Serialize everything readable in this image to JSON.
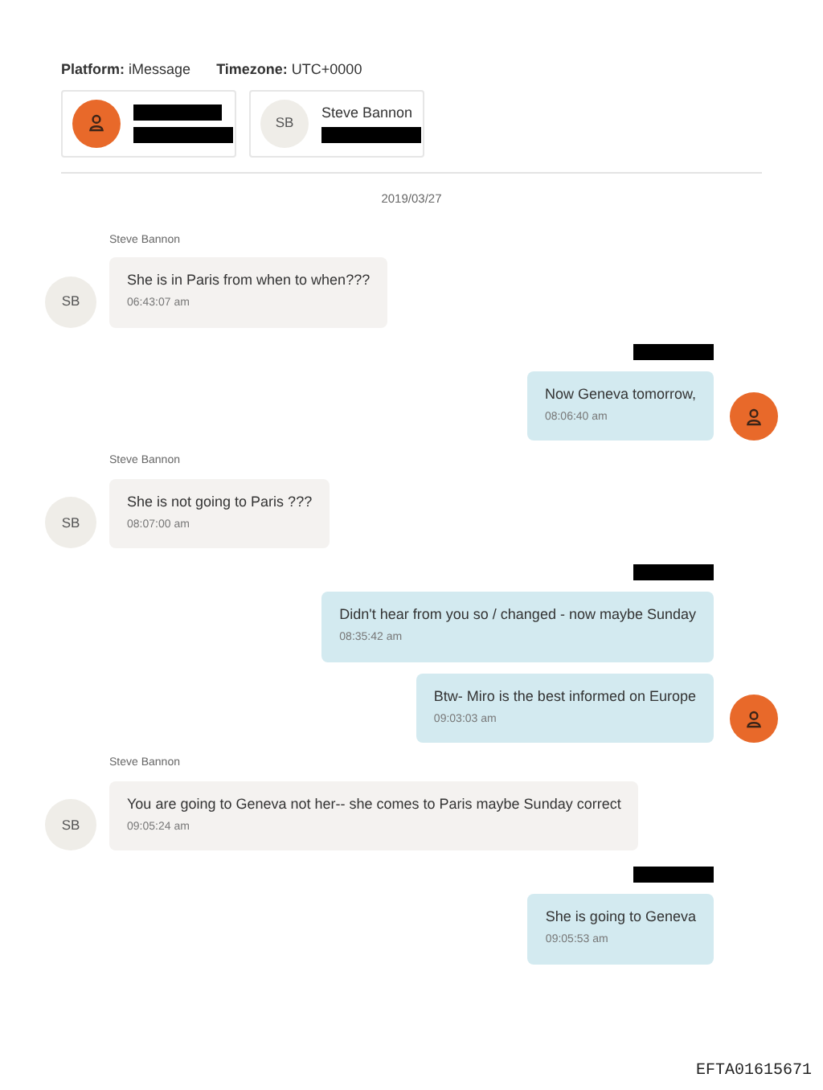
{
  "header": {
    "platform_label": "Platform:",
    "platform": "iMessage",
    "timezone_label": "Timezone:",
    "timezone": "UTC+0000"
  },
  "participants": [
    {
      "kind": "icon",
      "name_redacted": true,
      "handle_redacted": true
    },
    {
      "kind": "initials",
      "initials": "SB",
      "name": "Steve Bannon",
      "name_redacted": false,
      "handle_redacted": true
    }
  ],
  "date": "2019/03/27",
  "messages": [
    {
      "kind": "incoming",
      "sender": "Steve Bannon",
      "initials": "SB",
      "avatar": true,
      "text": "She is in Paris from when to when???",
      "time": "06:43:07 am"
    },
    {
      "kind": "outgoing",
      "sender_redacted": true,
      "avatar": true,
      "text": "Now Geneva tomorrow,",
      "time": "08:06:40 am"
    },
    {
      "kind": "incoming",
      "sender": "Steve Bannon",
      "initials": "SB",
      "avatar": true,
      "text": "She is not going to Paris ???",
      "time": "08:07:00 am"
    },
    {
      "kind": "outgoing",
      "sender_redacted": true,
      "avatar": false,
      "text": "Didn't hear from you so / changed - now maybe Sunday",
      "time": "08:35:42 am"
    },
    {
      "kind": "outgoing",
      "sender_redacted": false,
      "avatar": true,
      "text": "Btw- Miro is the best informed on Europe",
      "time": "09:03:03 am"
    },
    {
      "kind": "incoming",
      "sender": "Steve Bannon",
      "initials": "SB",
      "avatar": true,
      "text": "You are going to Geneva not her-- she comes to Paris maybe Sunday correct",
      "time": "09:05:24 am"
    },
    {
      "kind": "outgoing",
      "sender_redacted": true,
      "avatar": false,
      "text": "She is going to Geneva",
      "time": "09:05:53 am"
    }
  ],
  "footer": {
    "document_id": "EFTA01615671"
  }
}
